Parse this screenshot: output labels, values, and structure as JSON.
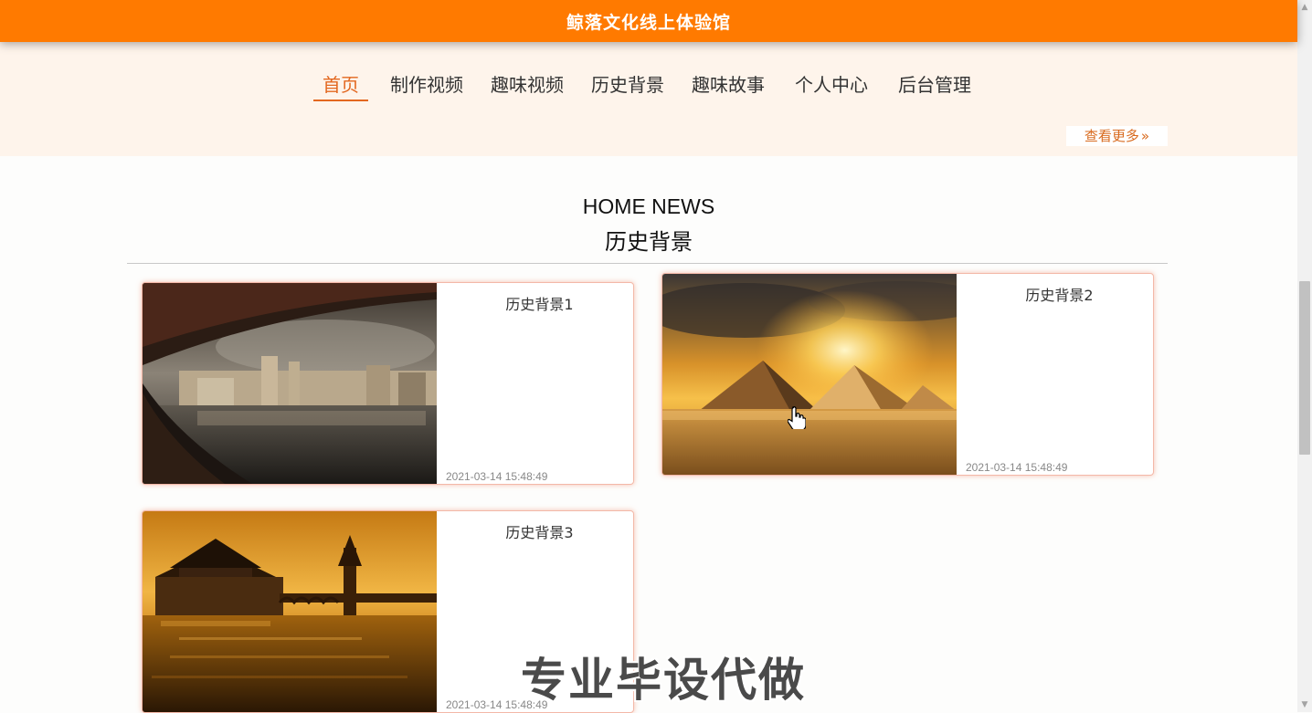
{
  "header": {
    "title": "鲸落文化线上体验馆",
    "accent_color": "#ff7a00"
  },
  "nav": {
    "items": [
      {
        "label": "首页",
        "active": true
      },
      {
        "label": "制作视频",
        "active": false
      },
      {
        "label": "趣味视频",
        "active": false
      },
      {
        "label": "历史背景",
        "active": false
      },
      {
        "label": "趣味故事",
        "active": false
      },
      {
        "label": "个人中心",
        "active": false
      },
      {
        "label": "后台管理",
        "active": false
      }
    ],
    "more_label": "查看更多",
    "more_icon": "double-chevron-right-icon"
  },
  "section": {
    "title_en": "HOME NEWS",
    "title_cn": "历史背景"
  },
  "cards": [
    {
      "title": "历史背景1",
      "date": "2021-03-14 15:48:49",
      "image": "city-waterfront-panorama"
    },
    {
      "title": "历史背景2",
      "date": "2021-03-14 15:48:49",
      "image": "pyramids-sunset"
    },
    {
      "title": "历史背景3",
      "date": "2021-03-14 15:48:49",
      "image": "ancient-tower-sunset"
    }
  ],
  "watermark": "专业毕设代做"
}
